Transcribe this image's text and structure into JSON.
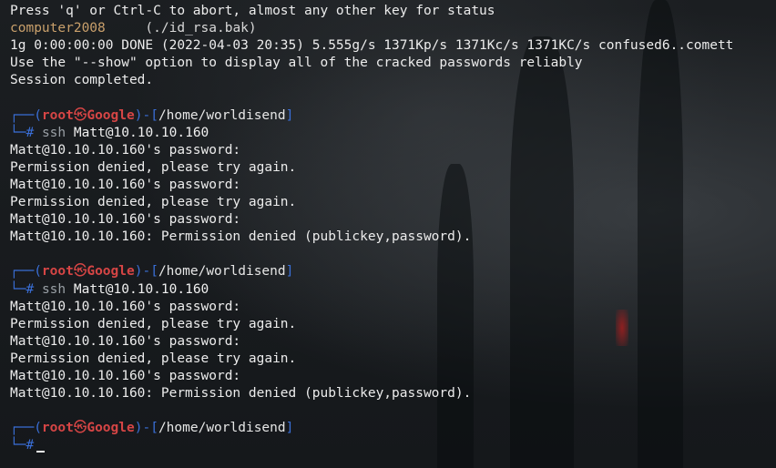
{
  "terminal": {
    "header_lines": [
      "Press 'q' or Ctrl-C to abort, almost any other key for status",
      "1g 0:00:00:00 DONE (2022-04-03 20:35) 5.555g/s 1371Kp/s 1371Kc/s 1371KC/s confused6..comett",
      "Use the \"--show\" option to display all of the cracked passwords reliably",
      "Session completed."
    ],
    "cracked": {
      "password": "computer2008",
      "file": "(./id_rsa.bak)"
    },
    "prompt": {
      "open": "┌──(",
      "user": "root",
      "skull": "㉿",
      "host": "Google",
      "mid": ")-[",
      "path": "/home/worldisend",
      "close": "]",
      "second_line": "└─#"
    },
    "blocks": [
      {
        "command": "ssh",
        "argument": "Matt@10.10.10.160",
        "output": [
          "Matt@10.10.10.160's password:",
          "Permission denied, please try again.",
          "Matt@10.10.10.160's password:",
          "Permission denied, please try again.",
          "Matt@10.10.10.160's password:",
          "Matt@10.10.10.160: Permission denied (publickey,password)."
        ]
      },
      {
        "command": "ssh",
        "argument": "Matt@10.10.10.160",
        "output": [
          "Matt@10.10.10.160's password:",
          "Permission denied, please try again.",
          "Matt@10.10.10.160's password:",
          "Permission denied, please try again.",
          "Matt@10.10.10.160's password:",
          "Matt@10.10.10.160: Permission denied (publickey,password)."
        ]
      }
    ]
  }
}
